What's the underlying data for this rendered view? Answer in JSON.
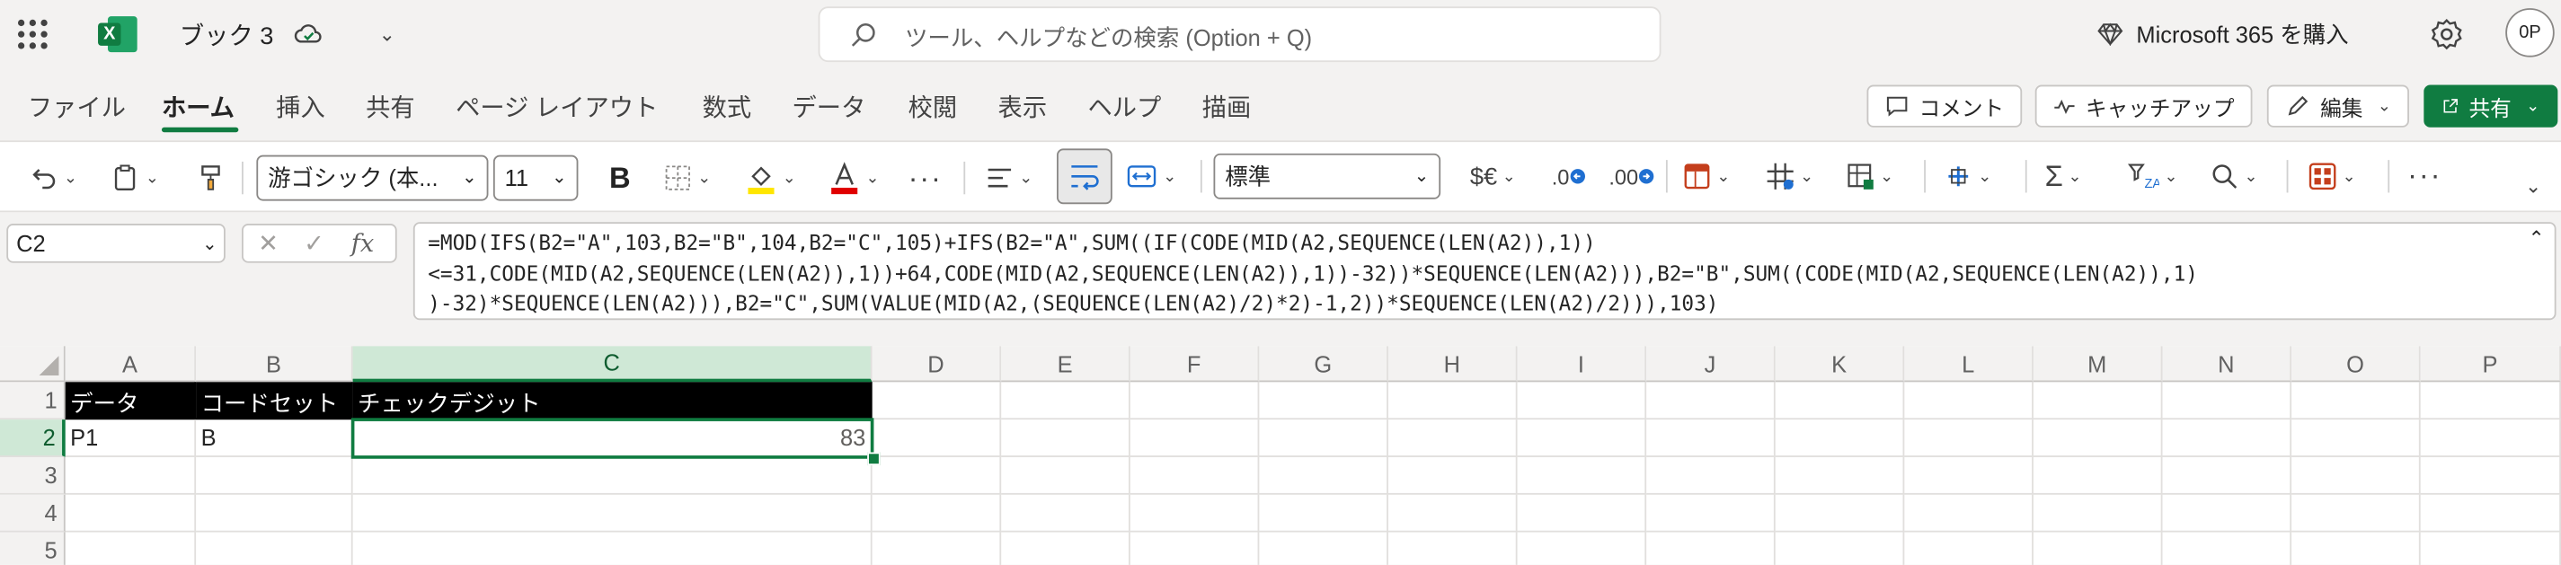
{
  "titlebar": {
    "app_icon": "excel-icon",
    "doc_title": "ブック 3",
    "sync_icon": "cloud-saved-icon",
    "search_placeholder": "ツール、ヘルプなどの検索 (Option + Q)",
    "m365_label": "Microsoft 365 を購入",
    "avatar_initials": "0P"
  },
  "tabs": [
    "ファイル",
    "ホーム",
    "挿入",
    "共有",
    "ページ レイアウト",
    "数式",
    "データ",
    "校閲",
    "表示",
    "ヘルプ",
    "描画"
  ],
  "active_tab": "ホーム",
  "ribbon_actions": {
    "comment": "コメント",
    "catchup": "キャッチアップ",
    "edit": "編集",
    "share": "共有"
  },
  "toolbar": {
    "font_name": "游ゴシック (本...",
    "font_size": "11",
    "bold": "B",
    "number_format": "標準",
    "currency": "$€",
    "decimal_decrease": ".0",
    "decimal_increase": ".00"
  },
  "formula_bar": {
    "name_box": "C2",
    "fx": "fx",
    "formula_lines": [
      "=MOD(IFS(B2=\"A\",103,B2=\"B\",104,B2=\"C\",105)+IFS(B2=\"A\",SUM((IF(CODE(MID(A2,SEQUENCE(LEN(A2)),1))",
      "<=31,CODE(MID(A2,SEQUENCE(LEN(A2)),1))+64,CODE(MID(A2,SEQUENCE(LEN(A2)),1))-32))*SEQUENCE(LEN(A2))),B2=\"B\",SUM((CODE(MID(A2,SEQUENCE(LEN(A2)),1)",
      ")-32)*SEQUENCE(LEN(A2))),B2=\"C\",SUM(VALUE(MID(A2,(SEQUENCE(LEN(A2)/2)*2)-1,2))*SEQUENCE(LEN(A2)/2))),103)"
    ]
  },
  "grid": {
    "columns": [
      "A",
      "B",
      "C",
      "D",
      "E",
      "F",
      "G",
      "H",
      "I",
      "J",
      "K",
      "L",
      "M",
      "N",
      "O",
      "P"
    ],
    "rows": [
      "1",
      "2",
      "3",
      "4",
      "5"
    ],
    "selected_column": "C",
    "selected_row": "2",
    "cells": {
      "A1": "データ",
      "B1": "コードセット",
      "C1": "チェックデジット",
      "A2": "P1",
      "B2": "B",
      "C2": "83"
    }
  },
  "colors": {
    "accent": "#107c41",
    "header_fill": "#000000"
  }
}
